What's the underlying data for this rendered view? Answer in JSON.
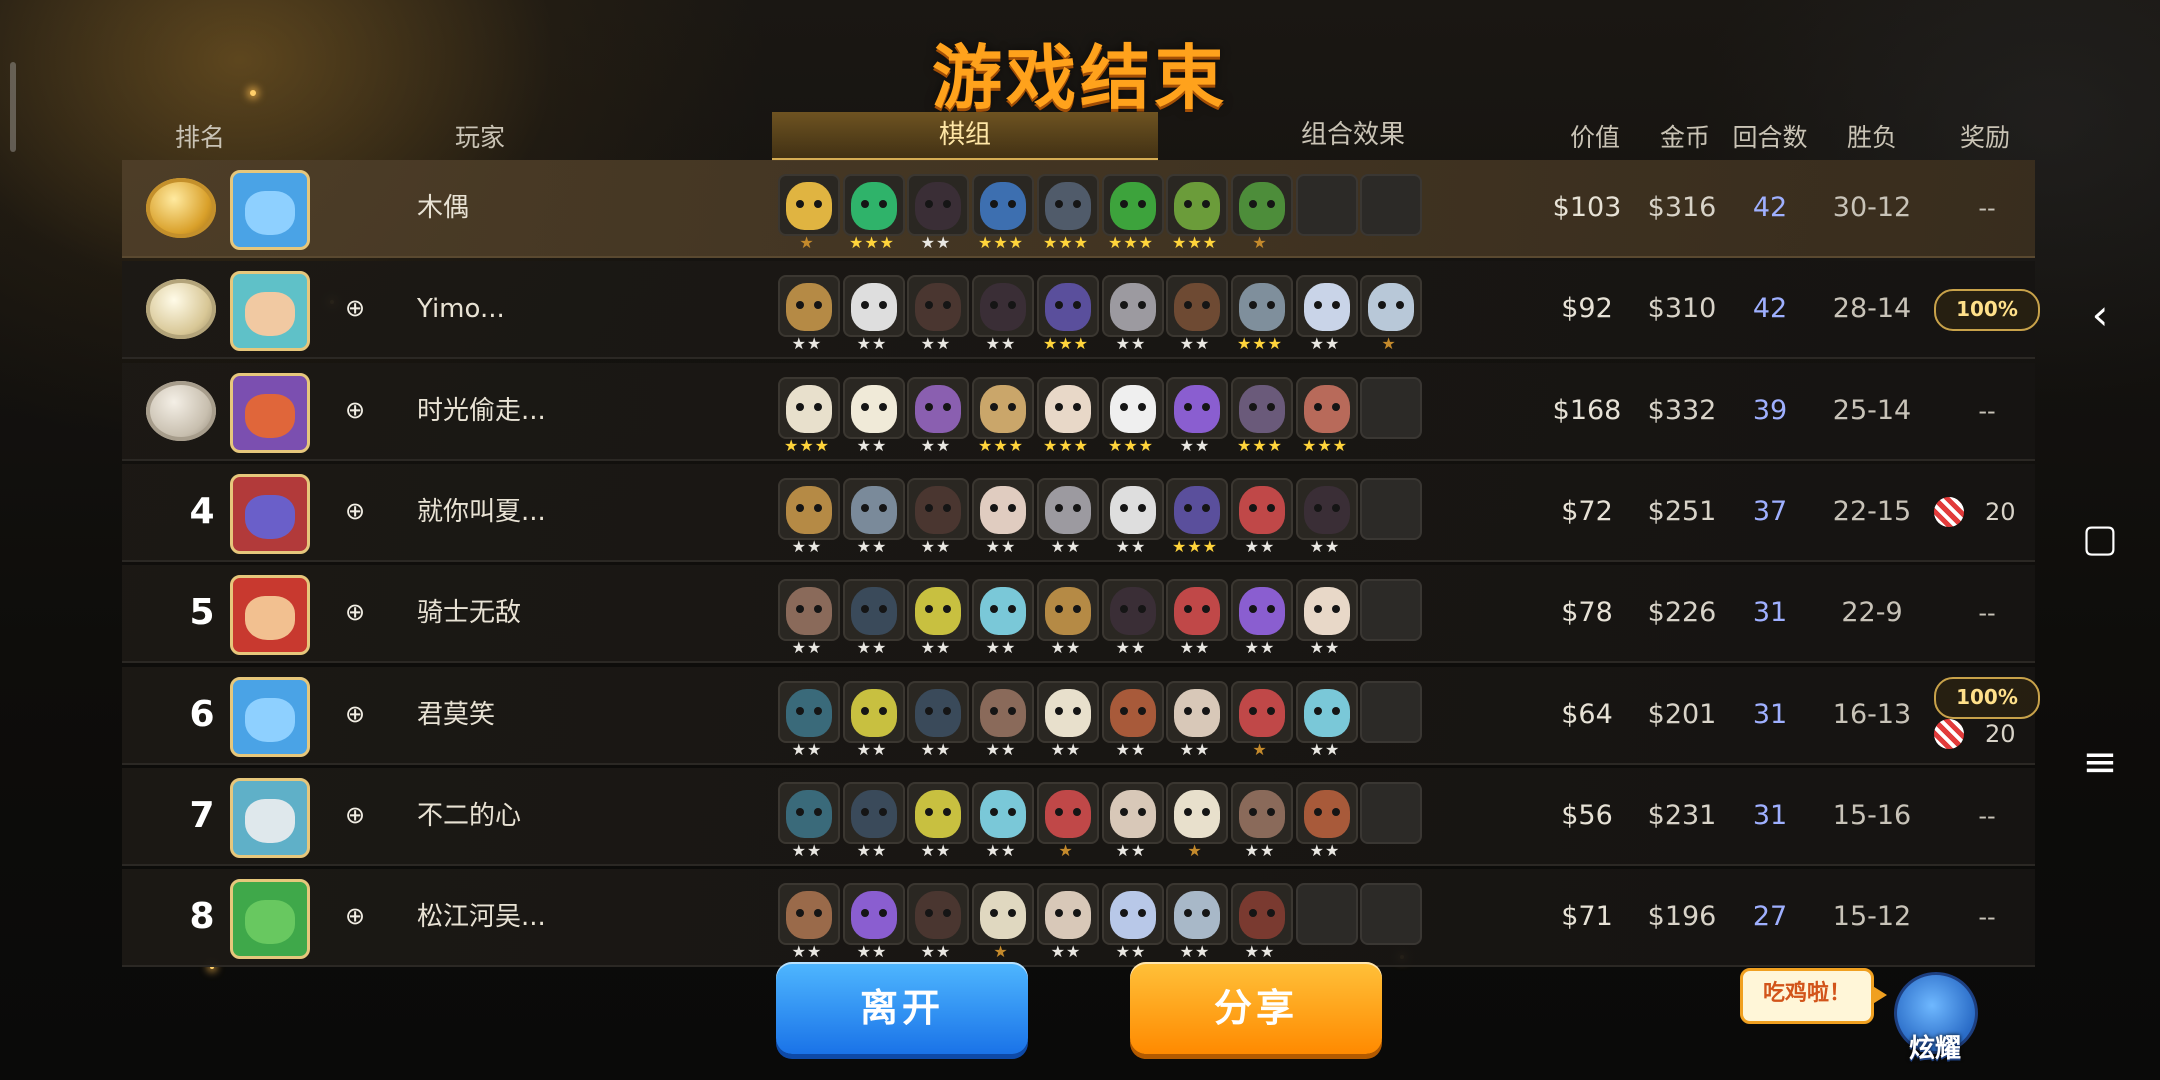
{
  "title": "游戏结束",
  "headers": {
    "rank": "排名",
    "player": "玩家",
    "lineup": "棋组",
    "synergy": "组合效果",
    "value": "价值",
    "gold": "金币",
    "rounds": "回合数",
    "winloss": "胜负",
    "reward": "奖励"
  },
  "players": [
    {
      "rank": "",
      "medal": "gold",
      "name": "木偶",
      "friend_icon": false,
      "value": "$103",
      "gold": "$316",
      "rounds": "42",
      "winloss": "30-12",
      "reward": "--",
      "avatar_color": "#4aa3e6",
      "face_color": "#8ed0ff",
      "pieces": [
        {
          "c": "#e0b441",
          "s": 1
        },
        {
          "c": "#2fb36a",
          "s": 3
        },
        {
          "c": "#3a2e36",
          "s": 2
        },
        {
          "c": "#3d6fb0",
          "s": 3
        },
        {
          "c": "#505b6a",
          "s": 3
        },
        {
          "c": "#3da33c",
          "s": 3
        },
        {
          "c": "#6b9c3a",
          "s": 3
        },
        {
          "c": "#4d8d3a",
          "s": 1
        },
        {
          "c": "",
          "s": 0
        },
        {
          "c": "",
          "s": 0
        }
      ]
    },
    {
      "rank": "",
      "medal": "silver",
      "name": "Yimo...",
      "friend_icon": true,
      "value": "$92",
      "gold": "$310",
      "rounds": "42",
      "winloss": "28-14",
      "reward": "",
      "badge": "100%",
      "avatar_color": "#5fc1c8",
      "face_color": "#f1c9a2",
      "pieces": [
        {
          "c": "#b58a45",
          "s": 2
        },
        {
          "c": "#dedede",
          "s": 2
        },
        {
          "c": "#4a3630",
          "s": 2
        },
        {
          "c": "#3a2e36",
          "s": 2
        },
        {
          "c": "#5a4f9c",
          "s": 3
        },
        {
          "c": "#9c9aa0",
          "s": 2
        },
        {
          "c": "#6e4a33",
          "s": 2
        },
        {
          "c": "#7f8f9c",
          "s": 3
        },
        {
          "c": "#c9d4e8",
          "s": 2
        },
        {
          "c": "#b8c8d8",
          "s": 1
        }
      ]
    },
    {
      "rank": "",
      "medal": "bronze",
      "name": "时光偷走...",
      "friend_icon": true,
      "value": "$168",
      "gold": "$332",
      "rounds": "39",
      "winloss": "25-14",
      "reward": "--",
      "avatar_color": "#7b4fb0",
      "face_color": "#e0663a",
      "pieces": [
        {
          "c": "#e8e0cc",
          "s": 3
        },
        {
          "c": "#f0ead8",
          "s": 2
        },
        {
          "c": "#8a5fb0",
          "s": 2
        },
        {
          "c": "#caa66a",
          "s": 3
        },
        {
          "c": "#e8d8c8",
          "s": 3
        },
        {
          "c": "#efefef",
          "s": 3
        },
        {
          "c": "#8a5ed0",
          "s": 2
        },
        {
          "c": "#6a5a7a",
          "s": 3
        },
        {
          "c": "#b86a5a",
          "s": 3
        },
        {
          "c": "",
          "s": 0
        }
      ]
    },
    {
      "rank": "4",
      "medal": "",
      "name": "就你叫夏...",
      "friend_icon": true,
      "value": "$72",
      "gold": "$251",
      "rounds": "37",
      "winloss": "22-15",
      "reward": "",
      "candy": "20",
      "avatar_color": "#b23a3a",
      "face_color": "#6a5fc9",
      "pieces": [
        {
          "c": "#b58a45",
          "s": 2
        },
        {
          "c": "#7a8a9a",
          "s": 2
        },
        {
          "c": "#4a3630",
          "s": 2
        },
        {
          "c": "#e0ccc0",
          "s": 2
        },
        {
          "c": "#9c9aa0",
          "s": 2
        },
        {
          "c": "#dedede",
          "s": 2
        },
        {
          "c": "#5a4f9c",
          "s": 3
        },
        {
          "c": "#c04848",
          "s": 2
        },
        {
          "c": "#3a2e36",
          "s": 2
        },
        {
          "c": "",
          "s": 0
        }
      ]
    },
    {
      "rank": "5",
      "medal": "",
      "name": "骑士无敌",
      "friend_icon": true,
      "value": "$78",
      "gold": "$226",
      "rounds": "31",
      "winloss": "22-9",
      "reward": "--",
      "avatar_color": "#c8392f",
      "face_color": "#f2c090",
      "pieces": [
        {
          "c": "#8a6a5a",
          "s": 2
        },
        {
          "c": "#3a4a5a",
          "s": 2
        },
        {
          "c": "#c8c040",
          "s": 2
        },
        {
          "c": "#7ac8d8",
          "s": 2
        },
        {
          "c": "#b58a45",
          "s": 2
        },
        {
          "c": "#3a2e36",
          "s": 2
        },
        {
          "c": "#c04848",
          "s": 2
        },
        {
          "c": "#8a5ed0",
          "s": 2
        },
        {
          "c": "#e8d8c8",
          "s": 2
        },
        {
          "c": "",
          "s": 0
        }
      ]
    },
    {
      "rank": "6",
      "medal": "",
      "name": "君莫笑",
      "friend_icon": true,
      "value": "$64",
      "gold": "$201",
      "rounds": "31",
      "winloss": "16-13",
      "reward": "",
      "badge": "100%",
      "candy": "20",
      "avatar_color": "#4aa3e6",
      "face_color": "#8ed0ff",
      "pieces": [
        {
          "c": "#3a6a7a",
          "s": 2
        },
        {
          "c": "#c8c040",
          "s": 2
        },
        {
          "c": "#3a4a5a",
          "s": 2
        },
        {
          "c": "#8a6a5a",
          "s": 2
        },
        {
          "c": "#e8e0cc",
          "s": 2
        },
        {
          "c": "#a85a3a",
          "s": 2
        },
        {
          "c": "#d8c8b8",
          "s": 2
        },
        {
          "c": "#c04848",
          "s": 1
        },
        {
          "c": "#7ac8d8",
          "s": 2
        },
        {
          "c": "",
          "s": 0
        }
      ]
    },
    {
      "rank": "7",
      "medal": "",
      "name": "不二的心",
      "friend_icon": true,
      "value": "$56",
      "gold": "$231",
      "rounds": "31",
      "winloss": "15-16",
      "reward": "--",
      "avatar_color": "#5fb0c8",
      "face_color": "#dfe8ec",
      "pieces": [
        {
          "c": "#3a6a7a",
          "s": 2
        },
        {
          "c": "#3a4a5a",
          "s": 2
        },
        {
          "c": "#c8c040",
          "s": 2
        },
        {
          "c": "#7ac8d8",
          "s": 2
        },
        {
          "c": "#c04848",
          "s": 1
        },
        {
          "c": "#d8c8b8",
          "s": 2
        },
        {
          "c": "#e8e0cc",
          "s": 1
        },
        {
          "c": "#8a6a5a",
          "s": 2
        },
        {
          "c": "#a85a3a",
          "s": 2
        },
        {
          "c": "",
          "s": 0
        }
      ]
    },
    {
      "rank": "8",
      "medal": "",
      "name": "松江河吴...",
      "friend_icon": true,
      "value": "$71",
      "gold": "$196",
      "rounds": "27",
      "winloss": "15-12",
      "reward": "--",
      "avatar_color": "#3fa84a",
      "face_color": "#68c860",
      "pieces": [
        {
          "c": "#9a6a4a",
          "s": 2
        },
        {
          "c": "#8a5ed0",
          "s": 2
        },
        {
          "c": "#4a3630",
          "s": 2
        },
        {
          "c": "#e0d8c0",
          "s": 1
        },
        {
          "c": "#d8c8b8",
          "s": 2
        },
        {
          "c": "#b8c8e8",
          "s": 2
        },
        {
          "c": "#a8b8c8",
          "s": 2
        },
        {
          "c": "#7a3a30",
          "s": 2
        },
        {
          "c": "",
          "s": 0
        },
        {
          "c": "",
          "s": 0
        }
      ]
    }
  ],
  "buttons": {
    "leave": "离开",
    "share": "分享"
  },
  "chicken_bubble": "吃鸡啦！",
  "show_off": "炫耀",
  "nav": {
    "back": "‹",
    "home": "▢",
    "menu": "≡"
  }
}
